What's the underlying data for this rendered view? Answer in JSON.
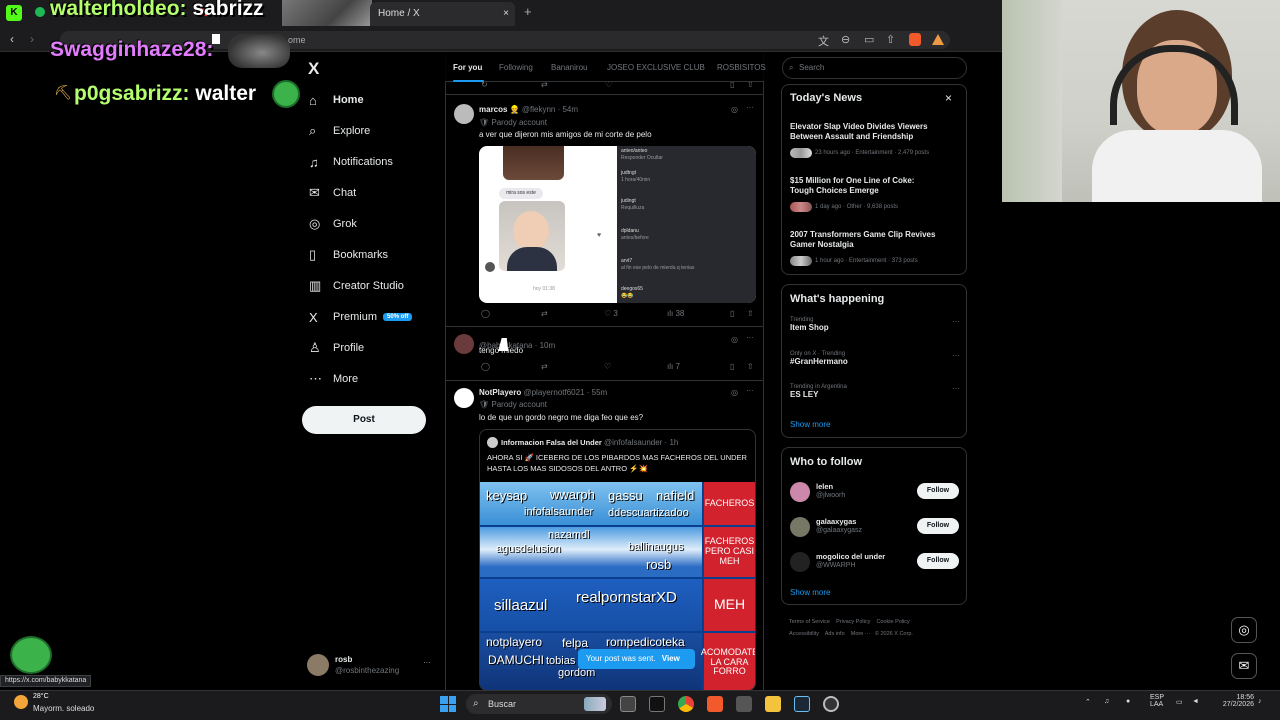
{
  "browser": {
    "tab_title": "Home / X",
    "tab_close": "×",
    "new_tab": "+",
    "url_fragment": "ome",
    "back": "‹",
    "forward": "›",
    "refresh": "↻"
  },
  "chat": [
    {
      "user": "walterholdeo:",
      "msg": "sabrizz"
    },
    {
      "user": "Swagginhaze28:",
      "msg": ""
    },
    {
      "user": "p0gsabrizz:",
      "msg": "walter"
    }
  ],
  "nav": {
    "logo": "X",
    "items": [
      {
        "label": "Home",
        "icon": "⌂"
      },
      {
        "label": "Explore",
        "icon": "⌕"
      },
      {
        "label": "Notifications",
        "icon": "♫"
      },
      {
        "label": "Chat",
        "icon": "✉"
      },
      {
        "label": "Grok",
        "icon": "◎"
      },
      {
        "label": "Bookmarks",
        "icon": "▯"
      },
      {
        "label": "Creator Studio",
        "icon": "▥"
      },
      {
        "label": "Premium",
        "icon": "X"
      },
      {
        "label": "Profile",
        "icon": "♙"
      },
      {
        "label": "More",
        "icon": "⋯"
      }
    ],
    "premium_badge": "50% off",
    "post_button": "Post",
    "account_name": "rosb",
    "account_handle": "@rosbinthezazing",
    "account_more": "···"
  },
  "feed": {
    "tabs": [
      "For you",
      "Following",
      "Bananirou",
      "JOSEO EXCLUSIVE CLUB",
      "ROSBISITOS"
    ],
    "posts": [
      {
        "name": "marcos 👷",
        "handle": "@flekynn · 54m",
        "parody": "Parody account",
        "text": "a ver que dijeron mis amigos de mi corte de pelo",
        "likes": "3",
        "views": "38",
        "image_texts": [
          "mira sos este",
          "hoy 01:38"
        ],
        "comments": [
          {
            "user": "anteo/anteo",
            "meta": "Responder  Ocultar"
          },
          {
            "user": "judtngt",
            "meta": "1 hora/40min"
          },
          {
            "user": "judingt",
            "meta": "Requilluza"
          },
          {
            "user": "dpldanu",
            "meta": "antes/before"
          },
          {
            "user": "arvt7",
            "meta": "al fin ese pelo de mierda q tenias"
          },
          {
            "user": "deegox65",
            "meta": "😂😂"
          }
        ]
      },
      {
        "name": "",
        "handle": "@babykkatana · 10m",
        "parody": "",
        "text": "tengo miedo",
        "likes": "",
        "views": "7"
      },
      {
        "name": "NotPlayero",
        "handle": "@playernotf6021 · 55m",
        "parody": "Parody account",
        "text": "lo de que un gordo negro me diga feo que es?",
        "quote_name": "Informacion Falsa del Under",
        "quote_handle": "@infofalsaunder · 1h",
        "quote_text": "AHORA SI 🚀 ICEBERG DE LOS PIBARDOS MAS FACHEROS DEL UNDER  HASTA LOS MAS SIDOSOS DEL ANTRO ⚡💥"
      }
    ],
    "iceberg": {
      "rows": [
        {
          "words": [
            "keysap",
            "wwarph",
            "gassu",
            "nafield",
            "infofalsaunder",
            "ddescuartizadoo"
          ],
          "label": "FACHEROS"
        },
        {
          "words": [
            "nazamdl",
            "agusdelusion",
            "ballinaugus",
            "rosb"
          ],
          "label": "FACHEROS PERO CASI MEH"
        },
        {
          "words": [
            "sillaazul",
            "realpornstarXD"
          ],
          "label": "MEH"
        },
        {
          "words": [
            "notplayero",
            "felpa",
            "rompedicoteka",
            "DAMUCHI",
            "tobias",
            "gordom"
          ],
          "label": "ACOMODATE LA CARA FORRO"
        }
      ]
    },
    "toast": {
      "text": "Your post was sent.",
      "action": "View"
    }
  },
  "right": {
    "search_placeholder": "Search",
    "news_title": "Today's News",
    "news_close": "×",
    "news": [
      {
        "headline": "Elevator Slap Video Divides Viewers Between Assault and Friendship",
        "meta": "23 hours ago · Entertainment · 2,479 posts"
      },
      {
        "headline": "$15 Million for One Line of Coke: Tough Choices Emerge",
        "meta": "1 day ago · Other · 9,638 posts"
      },
      {
        "headline": "2007 Transformers Game Clip Revives Gamer Nostalgia",
        "meta": "1 hour ago · Entertainment · 373 posts"
      }
    ],
    "happening_title": "What's happening",
    "trends": [
      {
        "sub": "Trending",
        "name": "Item Shop"
      },
      {
        "sub": "Only on X · Trending",
        "name": "#GranHermano"
      },
      {
        "sub": "Trending in Argentina",
        "name": "ES LEY"
      }
    ],
    "show_more": "Show more",
    "who_title": "Who to follow",
    "who": [
      {
        "name": "lelen",
        "handle": "@jlwoorh"
      },
      {
        "name": "galaaxygas",
        "handle": "@galaaxygasz"
      },
      {
        "name": "mogolico del under",
        "handle": "@WWARPH"
      }
    ],
    "follow_label": "Follow",
    "footer": [
      "Terms of Service",
      "Privacy Policy",
      "Cookie Policy",
      "Accessibility",
      "Ads info",
      "More ···",
      "© 2026 X Corp."
    ]
  },
  "status": {
    "link_hover": "https://x.com/babykkatana",
    "temperature": "28°C",
    "weather": "Mayorm. soleado"
  },
  "taskbar": {
    "search_placeholder": "Buscar",
    "lang": "ESP",
    "lang2": "LAA",
    "time": "18:56",
    "date": "27/2/2026"
  }
}
